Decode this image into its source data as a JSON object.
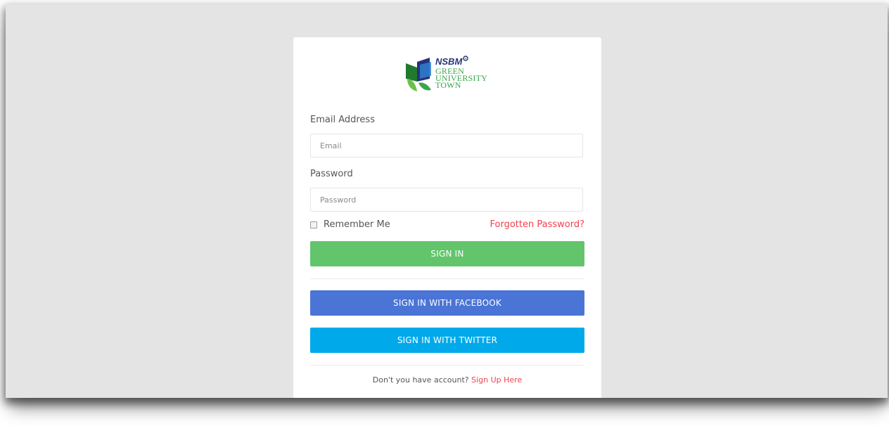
{
  "logo": {
    "brand": "NSBM",
    "lines": [
      "GREEN",
      "UNIVERSITY",
      "TOWN"
    ]
  },
  "form": {
    "email_label": "Email Address",
    "email_placeholder": "Email",
    "email_value": "",
    "password_label": "Password",
    "password_placeholder": "Password",
    "password_value": "",
    "remember_label": "Remember Me",
    "remember_checked": false,
    "forgot_label": "Forgotten Password?"
  },
  "buttons": {
    "sign_in": "SIGN IN",
    "facebook": "SIGN IN WITH FACEBOOK",
    "twitter": "SIGN IN WITH TWITTER"
  },
  "signup": {
    "prompt": "Don't you have account?",
    "link": "Sign Up Here"
  },
  "colors": {
    "sign_in": "#62c56b",
    "facebook": "#4a74d6",
    "twitter": "#00aaea",
    "link": "#f0414f",
    "background": "#e4e4e4"
  }
}
